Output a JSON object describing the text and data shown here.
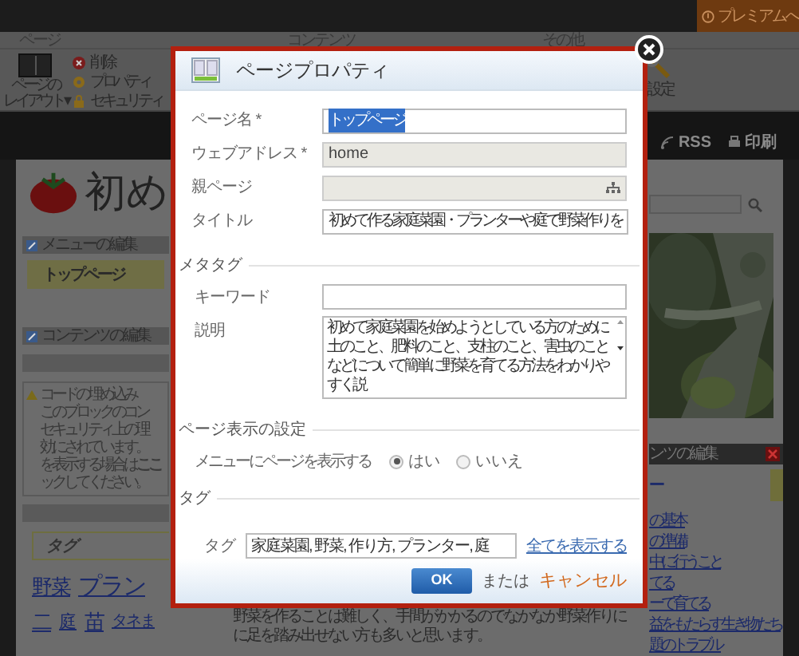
{
  "top_bar": {
    "premium_button": "プレミアムへ"
  },
  "ribbon": {
    "groups": [
      "ページ",
      "コンテンツ",
      "その他"
    ],
    "layout_button": [
      "ページの",
      "レイアウト ▾"
    ],
    "actions": [
      {
        "label": "削除",
        "kind": "delete"
      },
      {
        "label": "プロパティ",
        "kind": "properties"
      },
      {
        "label": "セキュリティ",
        "kind": "security"
      }
    ],
    "settings_button": "設定"
  },
  "site_header": {
    "links": [
      {
        "label": "RSS",
        "kind": "rss"
      },
      {
        "label": "印刷",
        "kind": "print"
      }
    ],
    "site_title": "初め"
  },
  "left_column": {
    "menu_panel": {
      "title": "メニューの編集",
      "items": [
        {
          "label": "トップページ",
          "selected": true
        }
      ]
    },
    "content_panel": {
      "title": "コンテンツの編集"
    },
    "notice": {
      "title": "コードの埋め込み",
      "lines": [
        "このブロックのコン",
        "セキュリティ上の理",
        "効にされています。",
        "を表示する場合は **ここ**",
        "ックしてください。"
      ]
    },
    "tags": {
      "title": "タグ",
      "cloud": [
        {
          "label": "野菜",
          "kind": "medium"
        },
        {
          "label": "プラン",
          "kind": "large"
        },
        {
          "label": "二",
          "kind": "medium"
        },
        {
          "label": "庭",
          "kind": "small"
        },
        {
          "label": "苗",
          "kind": "medium"
        },
        {
          "label": "タネま",
          "kind": "tiny"
        }
      ]
    }
  },
  "intro_text": [
    "野菜を作ることは難しく、手間がかかるのでなかなか野菜作りに",
    "に足を踏み出せない方も多いと思います。"
  ],
  "right_column": {
    "panel": {
      "title": "ンツの編集",
      "highlight": "ー",
      "links": [
        "の基本",
        "の準備",
        "中に行うこと",
        "てる",
        "ーで育てる",
        "益をもたらす生き物たち",
        "題のトラブル"
      ]
    }
  },
  "dialog": {
    "title": "ページプロパティ",
    "fields": [
      {
        "label": "ページ名 *",
        "value": "トップページ",
        "kind": "text",
        "highlighted": true
      },
      {
        "label": "ウェブアドレス *",
        "value": "home",
        "kind": "readonly"
      },
      {
        "label": "親ページ",
        "kind": "picker"
      },
      {
        "label": "タイトル",
        "value": "初めて作る家庭菜園・プランターや庭で野菜作りを",
        "kind": "text",
        "highlighted": false
      }
    ],
    "meta": {
      "heading": "メタタグ",
      "keyword_label": "キーワード",
      "description_label": "説明",
      "description": "初めて家庭菜園を始めようとしている方のために土のこと、肥料のこと、支柱のこと、害虫のことなどについて簡単に野菜を育てる方法をわかりやすく説"
    },
    "display": {
      "heading": "ページ表示の設定",
      "label": "メニューにページを表示する",
      "options": [
        {
          "label": "はい",
          "selected": true
        },
        {
          "label": "いいえ",
          "selected": false
        }
      ]
    },
    "tags": {
      "heading": "タグ",
      "label": "タグ",
      "value": "家庭菜園, 野菜, 作り方, プランター, 庭",
      "show_all_link": "全てを表示する"
    },
    "ok_button": "OK",
    "or_text": "または",
    "cancel_link": "キャンセル"
  }
}
